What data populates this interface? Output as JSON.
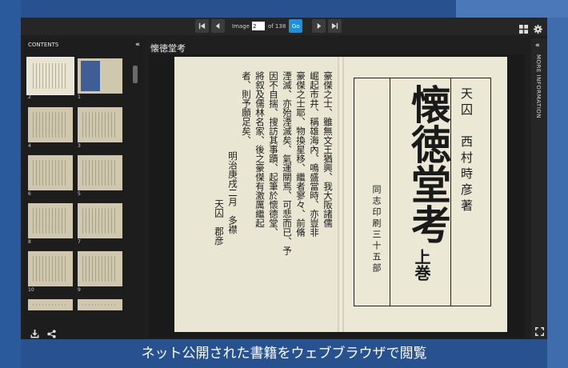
{
  "toolbar": {
    "image_label": "Image",
    "image_value": "2",
    "of_label": "of 138",
    "go_label": "Go",
    "accent": "#1e8fd9"
  },
  "contents": {
    "title": "CONTENTS",
    "thumbnails": [
      {
        "left": "2",
        "right": "1"
      },
      {
        "left": "4",
        "right": "3"
      },
      {
        "left": "6",
        "right": "5"
      },
      {
        "left": "8",
        "right": "7"
      },
      {
        "left": "10",
        "right": "9"
      }
    ]
  },
  "document": {
    "title": "懐徳堂考",
    "left_page_columns": [
      "豪傑之士、雖無文王猶興、我大阪諸儒",
      "崛起市井、稱雄海內、鳴盛當時、亦豈非",
      "豪傑之士耶、物換星移、繼者寥々、前脩",
      "湮滅、亦殆湮滅矣、氣運關焉、可悲而已、予",
      "因不自揣、搜訪其事蹟、起筆於懷德堂、",
      "將叙及儒林名家、後之豪傑有激厲繼起",
      "者、則予願足矣、",
      "明治庚戌二月　多襟",
      "天囚　郡彦"
    ],
    "right_page": {
      "author": "天囚　西村時彦著",
      "title": "懐徳堂考",
      "publisher": "同志印刷三十五部",
      "volume": "上巻"
    }
  },
  "more_info": {
    "label": "MORE INFORMATION"
  },
  "caption": "ネット公開された書籍をウェブブラウザで閲覧"
}
